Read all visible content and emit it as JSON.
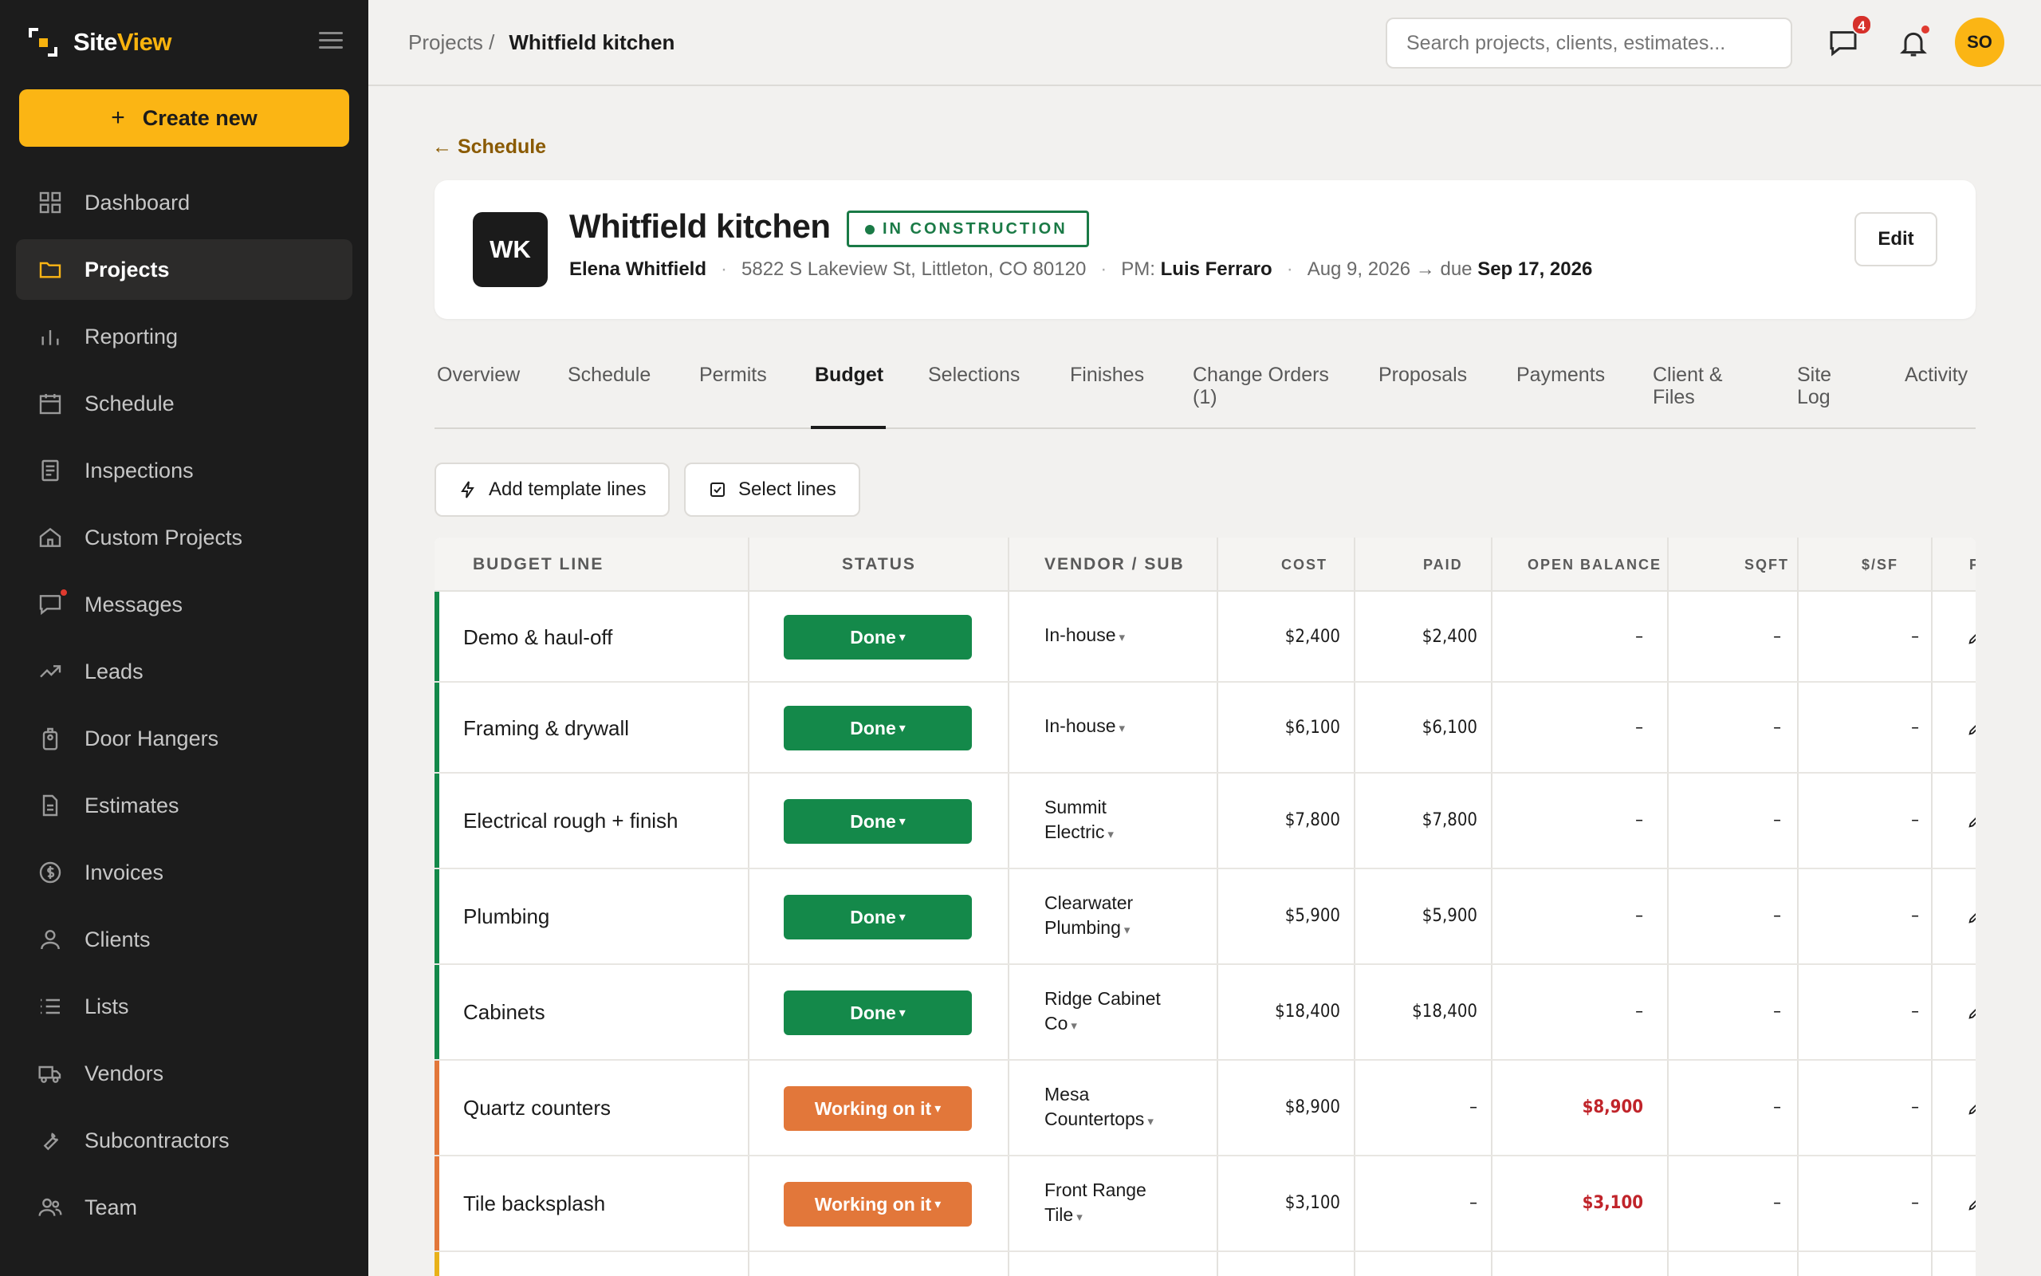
{
  "app": {
    "brand_a": "Site",
    "brand_b": "View"
  },
  "sidebar": {
    "create_label": "Create new",
    "items": [
      {
        "label": "Dashboard",
        "icon": "grid-icon"
      },
      {
        "label": "Projects",
        "icon": "folder-icon",
        "active": true
      },
      {
        "label": "Reporting",
        "icon": "bar-chart-icon"
      },
      {
        "label": "Schedule",
        "icon": "calendar-icon"
      },
      {
        "label": "Inspections",
        "icon": "document-icon"
      },
      {
        "label": "Custom Projects",
        "icon": "home-icon"
      },
      {
        "label": "Messages",
        "icon": "chat-icon"
      },
      {
        "label": "Leads",
        "icon": "trend-icon"
      },
      {
        "label": "Door Hangers",
        "icon": "tag-icon"
      },
      {
        "label": "Estimates",
        "icon": "file-icon"
      },
      {
        "label": "Invoices",
        "icon": "dollar-icon"
      },
      {
        "label": "Clients",
        "icon": "user-icon"
      },
      {
        "label": "Lists",
        "icon": "list-icon"
      },
      {
        "label": "Vendors",
        "icon": "truck-icon"
      },
      {
        "label": "Subcontractors",
        "icon": "wrench-icon"
      },
      {
        "label": "Team",
        "icon": "users-icon"
      }
    ]
  },
  "topbar": {
    "crumb_parent": "Projects /",
    "crumb_current": "Whitfield kitchen",
    "search_placeholder": "Search projects, clients, estimates...",
    "messages_badge": "4",
    "avatar_initials": "SO"
  },
  "project": {
    "back_label": "← Schedule",
    "initials": "WK",
    "title": "Whitfield kitchen",
    "status": "IN CONSTRUCTION",
    "client": "Elena Whitfield",
    "address": "5822 S Lakeview St, Littleton, CO 80120",
    "pm_label": "PM:",
    "pm_name": "Luis Ferraro",
    "dates_prefix": "Aug 9, 2026 → due",
    "due_date": "Sep 17, 2026",
    "edit_label": "Edit"
  },
  "tabs": [
    {
      "label": "Overview"
    },
    {
      "label": "Schedule"
    },
    {
      "label": "Permits"
    },
    {
      "label": "Budget",
      "active": true
    },
    {
      "label": "Selections"
    },
    {
      "label": "Finishes"
    },
    {
      "label": "Change Orders\n(1)"
    },
    {
      "label": "Proposals"
    },
    {
      "label": "Payments"
    },
    {
      "label": "Client &\nFiles"
    },
    {
      "label": "Site\nLog"
    },
    {
      "label": "Activity"
    }
  ],
  "actions": {
    "add_template": "Add template lines",
    "select_lines": "Select lines"
  },
  "colors": {
    "done": "#14894a",
    "working": "#e2773a",
    "accent": "#fbb514"
  },
  "table": {
    "headers": {
      "line": "BUDGET LINE",
      "status": "STATUS",
      "vendor": "VENDOR / SUB",
      "cost": "COST",
      "paid": "PAID",
      "open": "OPEN BALANCE",
      "sqft": "SQFT",
      "persf": "$/SF",
      "more": "F"
    },
    "rows": [
      {
        "line": "Demo & haul-off",
        "status": "Done",
        "vendor": "In-house",
        "cost": "$2,400",
        "paid": "$2,400",
        "open": "–",
        "sqft": "–",
        "persf": "–"
      },
      {
        "line": "Framing & drywall",
        "status": "Done",
        "vendor": "In-house",
        "cost": "$6,100",
        "paid": "$6,100",
        "open": "–",
        "sqft": "–",
        "persf": "–"
      },
      {
        "line": "Electrical rough + finish",
        "status": "Done",
        "vendor": "Summit Electric",
        "cost": "$7,800",
        "paid": "$7,800",
        "open": "–",
        "sqft": "–",
        "persf": "–"
      },
      {
        "line": "Plumbing",
        "status": "Done",
        "vendor": "Clearwater Plumbing",
        "cost": "$5,900",
        "paid": "$5,900",
        "open": "–",
        "sqft": "–",
        "persf": "–"
      },
      {
        "line": "Cabinets",
        "status": "Done",
        "vendor": "Ridge Cabinet Co",
        "cost": "$18,400",
        "paid": "$18,400",
        "open": "–",
        "sqft": "–",
        "persf": "–"
      },
      {
        "line": "Quartz counters",
        "status": "Working on it",
        "vendor": "Mesa Countertops",
        "cost": "$8,900",
        "paid": "–",
        "open": "$8,900",
        "sqft": "–",
        "persf": "–"
      },
      {
        "line": "Tile backsplash",
        "status": "Working on it",
        "vendor": "Front Range Tile",
        "cost": "$3,100",
        "paid": "–",
        "open": "$3,100",
        "sqft": "–",
        "persf": "–"
      }
    ]
  }
}
